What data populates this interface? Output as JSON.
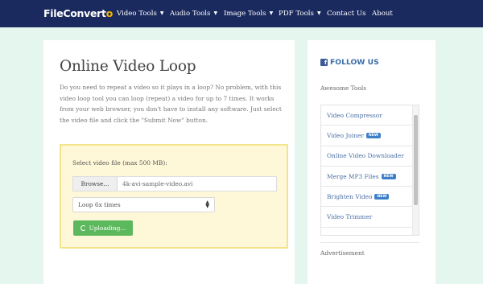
{
  "nav": {
    "logo_main": "FileConvert",
    "logo_accent": "o",
    "items": [
      {
        "label": "Video Tools",
        "dropdown": true
      },
      {
        "label": "Audio Tools",
        "dropdown": true
      },
      {
        "label": "Image Tools",
        "dropdown": true
      },
      {
        "label": "PDF Tools",
        "dropdown": true
      },
      {
        "label": "Contact Us",
        "dropdown": false
      },
      {
        "label": "About",
        "dropdown": false
      }
    ],
    "caret": "▼"
  },
  "main": {
    "title": "Online Video Loop",
    "intro": "Do you need to repeat a video so it plays in a loop? No problem, with this video loop tool you can loop (repeat) a video for up to 7 times. It works from your web browser, you don't have to install any software. Just select the video file and click the \"Submit Now\" button.",
    "upload": {
      "label": "Select video file (max 500 MB):",
      "browse_label": "Browse...",
      "file_name": "4k-avi-sample-video.avi",
      "loop_select_value": "Loop 6x times",
      "button_label": "Uploading..."
    }
  },
  "sidebar": {
    "follow_label": "FOLLOW US",
    "awesome_label": "Awesome Tools",
    "new_badge": "NEW",
    "tools": [
      {
        "label": "Video Compressor",
        "new": false
      },
      {
        "label": "Video Joiner",
        "new": true
      },
      {
        "label": "Online Video Downloader",
        "new": false
      },
      {
        "label": "Merge MP3 Files",
        "new": true
      },
      {
        "label": "Brighten Video",
        "new": true
      },
      {
        "label": "Video Trimmer",
        "new": false
      }
    ],
    "advertisement_label": "Advertisement"
  },
  "colors": {
    "nav_bg": "#1b2a5e",
    "accent": "#f5b400",
    "button_green": "#5cb85c",
    "link_blue": "#4a6fa5",
    "upload_bg": "#fff8d8"
  }
}
